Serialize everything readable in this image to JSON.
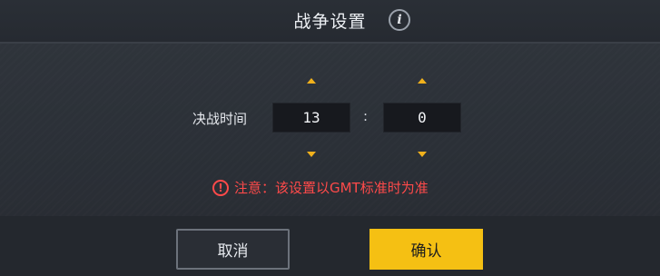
{
  "dialog": {
    "title": "战争设置",
    "info_icon": "info-icon"
  },
  "battle_time": {
    "label": "决战时间",
    "hour": "13",
    "separator": ":",
    "minute": "0"
  },
  "warning": {
    "icon": "exclamation-circle-icon",
    "text": "注意：该设置以GMT标准时为准"
  },
  "buttons": {
    "cancel_label": "取消",
    "confirm_label": "确认"
  },
  "colors": {
    "accent": "#f5c013",
    "arrow": "#f1b11c",
    "warning": "#ff4a4a",
    "background": "#20242b"
  }
}
